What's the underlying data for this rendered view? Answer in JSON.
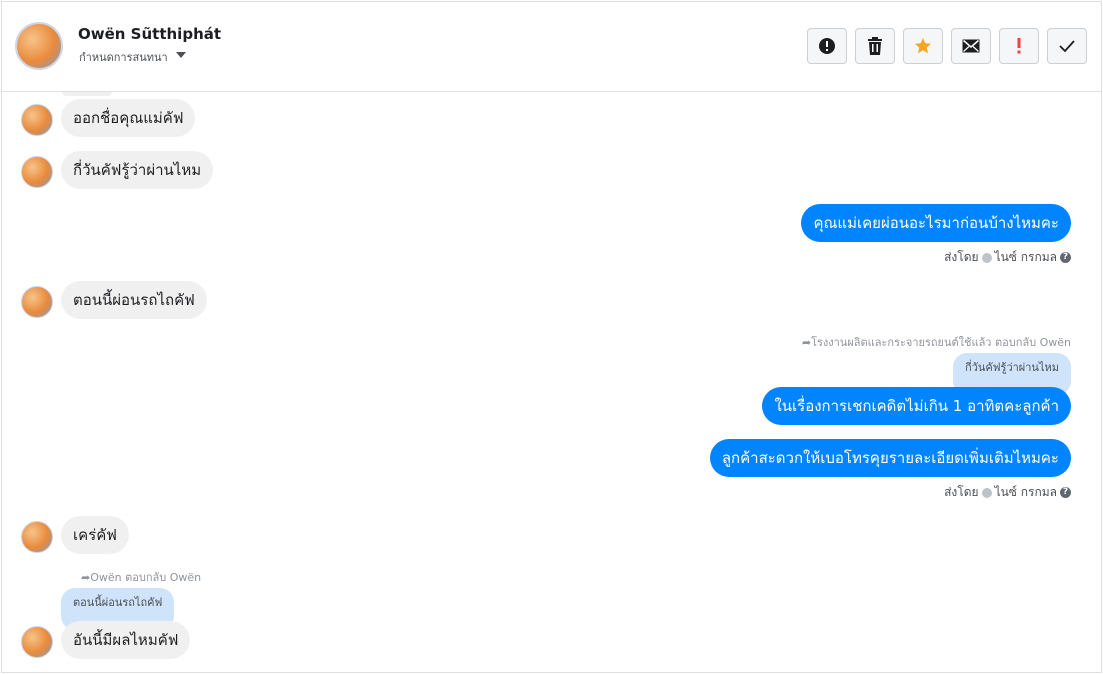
{
  "header": {
    "name": "Owën Sũtthiphát",
    "subtitle": "กำหนดการสนทนา",
    "buttons": [
      {
        "name": "alert-button",
        "icon": "exclamation-circle-icon"
      },
      {
        "name": "delete-button",
        "icon": "trash-icon"
      },
      {
        "name": "star-button",
        "icon": "star-icon",
        "color": "#f5a623"
      },
      {
        "name": "email-button",
        "icon": "envelope-icon"
      },
      {
        "name": "important-button",
        "icon": "exclamation-icon",
        "color": "#fa3e3e"
      },
      {
        "name": "done-button",
        "icon": "check-icon"
      }
    ]
  },
  "messages": [
    {
      "dir": "in",
      "text": "ออกชื่อคุณแม่คัฟ"
    },
    {
      "dir": "in",
      "text": "กี่วันคัฟรู้ว่าผ่านไหม"
    },
    {
      "dir": "out",
      "text": "คุณแม่เคยผ่อนอะไรมาก่อนบ้างไหมคะ"
    },
    {
      "dir": "in",
      "text": "ตอนนี้ผ่อนรถไถคัฟ"
    },
    {
      "dir": "out",
      "text": "ในเรื่องการเชกเคดิตไม่เกิน 1 อาทิตคะลูกค้า",
      "reply_meta": "โรงงานผลิตและกระจายรถยนต์ใช้แล้ว ตอบกลับ Owën",
      "quote": "กี่วันคัฟรู้ว่าผ่านไหม"
    },
    {
      "dir": "out",
      "text": "ลูกค้าสะดวกให้เบอโทรคุยรายละเอียดเพิ่มเติมไหมคะ"
    },
    {
      "dir": "in",
      "text": "เคร่คัฟ"
    },
    {
      "dir": "in",
      "text": "อันนี้มีผลไหมคัฟ",
      "reply_meta": "Owën ตอบกลับ Owën",
      "quote": "ตอนนี้ผ่อนรถไถคัฟ"
    }
  ],
  "sent_labels": [
    {
      "prefix": "ส่งโดย",
      "by": "ไนซ์ กรกมล"
    },
    {
      "prefix": "ส่งโดย",
      "by": "ไนซ์ กรกมล"
    }
  ],
  "colors": {
    "outgoing": "#0084ff",
    "incoming": "#f1f0f0",
    "quote": "#cfe3fb"
  }
}
